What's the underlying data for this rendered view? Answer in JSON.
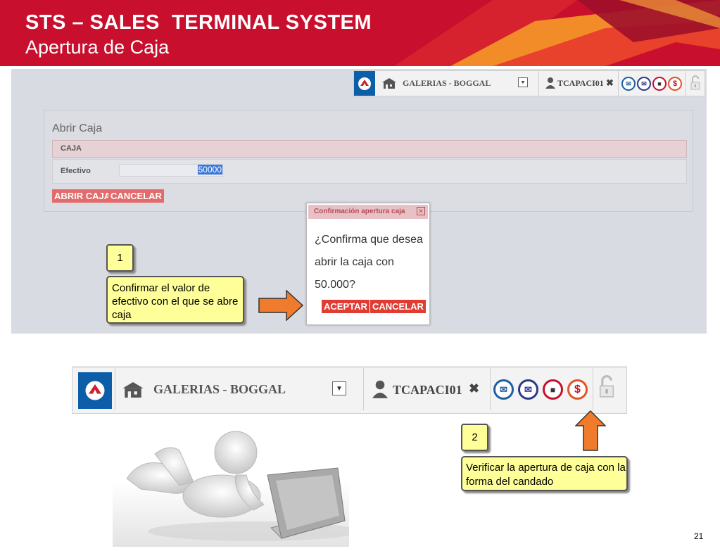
{
  "slide": {
    "title_line1": "STS – SALES  TERMINAL SYSTEM",
    "title_line2": "Apertura de Caja",
    "page_number": "21",
    "colors": {
      "banner_red": "#c8102e",
      "banner_orange": "#f28c28",
      "note_yellow": "#ffff99",
      "arrow_orange": "#f07b2c"
    }
  },
  "top_screenshot": {
    "toolbar": {
      "store": "GALERIAS - BOGGAL",
      "user": "TCAPACI01",
      "icons": [
        "logo-icon",
        "store-icon",
        "dropdown-arrow-icon",
        "user-icon",
        "close-icon",
        "mail-icon",
        "envelope-icon",
        "bag-icon",
        "dollar-icon",
        "padlock-icon"
      ]
    },
    "panel": {
      "title": "Abrir Caja",
      "section": "CAJA",
      "field_label": "Efectivo",
      "field_value": "50000",
      "open_button": "ABRIR CAJA",
      "cancel_button": "CANCELAR"
    },
    "dialog": {
      "title": "Confirmación apertura caja",
      "message": "¿Confirma que desea abrir la caja con 50.000?",
      "accept": "ACEPTAR",
      "cancel": "CANCELAR"
    }
  },
  "callouts": [
    {
      "number": "1",
      "text": "Confirmar el valor de efectivo con el que se abre caja"
    },
    {
      "number": "2",
      "text": "Verificar la apertura de caja con la forma del candado"
    }
  ],
  "bottom_toolbar": {
    "store": "GALERIAS - BOGGAL",
    "user": "TCAPACI01"
  }
}
